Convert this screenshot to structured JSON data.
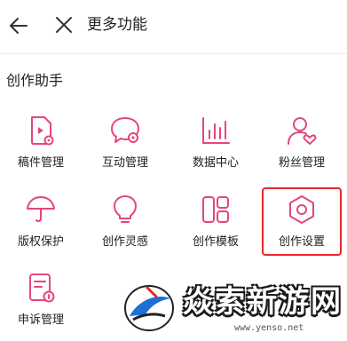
{
  "header": {
    "title": "更多功能"
  },
  "section": {
    "title": "创作助手"
  },
  "tools": [
    {
      "label": "稿件管理",
      "icon": "manuscript-icon"
    },
    {
      "label": "互动管理",
      "icon": "interaction-icon"
    },
    {
      "label": "数据中心",
      "icon": "data-chart-icon"
    },
    {
      "label": "粉丝管理",
      "icon": "fans-icon"
    },
    {
      "label": "版权保护",
      "icon": "umbrella-icon"
    },
    {
      "label": "创作灵感",
      "icon": "lightbulb-icon"
    },
    {
      "label": "创作模板",
      "icon": "template-icon"
    },
    {
      "label": "创作设置",
      "icon": "settings-hexagon-icon"
    },
    {
      "label": "申诉管理",
      "icon": "appeal-doc-icon"
    }
  ],
  "watermark": {
    "text": "焱索新游网",
    "url": "www.yenso.net"
  },
  "colors": {
    "accent": "#e6457a",
    "highlight": "#e8262a"
  }
}
